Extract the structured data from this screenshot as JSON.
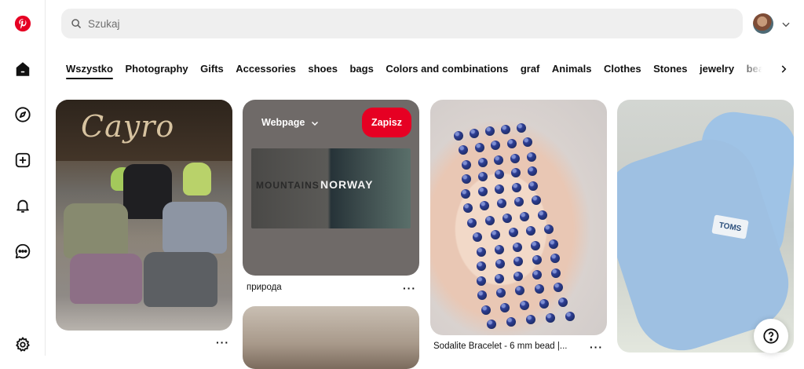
{
  "search": {
    "placeholder": "Szukaj"
  },
  "tabs": [
    {
      "label": "Wszystko",
      "active": true
    },
    {
      "label": "Photography"
    },
    {
      "label": "Gifts"
    },
    {
      "label": "Accessories"
    },
    {
      "label": "shoes"
    },
    {
      "label": "bags"
    },
    {
      "label": "Colors and combinations"
    },
    {
      "label": "graf"
    },
    {
      "label": "Animals"
    },
    {
      "label": "Clothes"
    },
    {
      "label": "Stones"
    },
    {
      "label": "jewelry"
    },
    {
      "label": "beauty"
    }
  ],
  "pins": {
    "bags": {
      "sign_text": "Cayro",
      "more": "···"
    },
    "webpage": {
      "source_label": "Webpage",
      "save_label": "Zapisz",
      "preview_left_text": "MOUNTAINS",
      "preview_right_text": "NORWAY",
      "title": "природа",
      "more": "···"
    },
    "bracelet": {
      "title": "Sodalite Bracelet - 6 mm bead |...",
      "more": "···"
    },
    "shoes": {
      "brand_tag": "TOMS"
    }
  },
  "colors": {
    "brand_red": "#e60023",
    "search_bg": "#efefef"
  }
}
